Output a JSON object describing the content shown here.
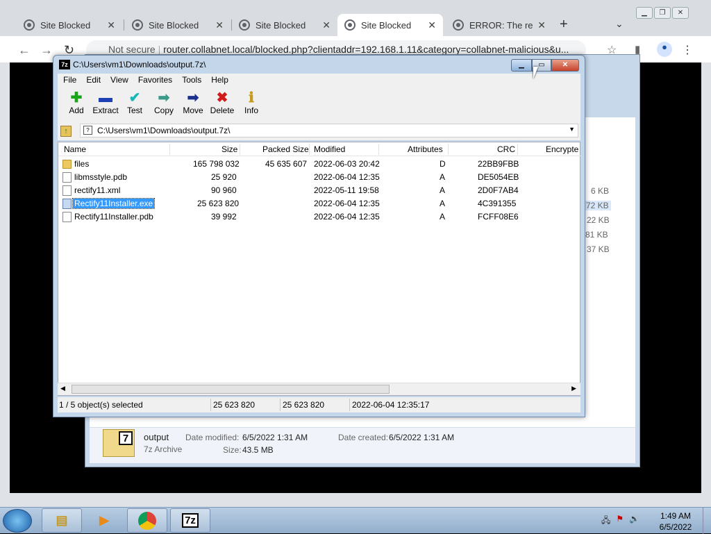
{
  "browser": {
    "tabs": [
      {
        "label": "Site Blocked"
      },
      {
        "label": "Site Blocked"
      },
      {
        "label": "Site Blocked"
      },
      {
        "label": "Site Blocked"
      },
      {
        "label": "ERROR: The requ"
      }
    ],
    "omnibox": {
      "security": "Not secure",
      "url": "router.collabnet.local/blocked.php?clientaddr=192.168.1.11&category=collabnet-malicious&u..."
    }
  },
  "background_explorer": {
    "sizes": [
      "6 KB",
      "72 KB",
      "22 KB",
      "81 KB",
      "37 KB"
    ],
    "details": {
      "name": "output",
      "type": "7z Archive",
      "modified_label": "Date modified:",
      "modified_value": "6/5/2022 1:31 AM",
      "created_label": "Date created:",
      "created_value": "6/5/2022 1:31 AM",
      "size_label": "Size:",
      "size_value": "43.5 MB"
    }
  },
  "sevenzip": {
    "title": "C:\\Users\\vm1\\Downloads\\output.7z\\",
    "menu": [
      "File",
      "Edit",
      "View",
      "Favorites",
      "Tools",
      "Help"
    ],
    "toolbar": [
      {
        "label": "Add",
        "glyph": "+",
        "color": "#1aa51a"
      },
      {
        "label": "Extract",
        "glyph": "━",
        "color": "#1c3fb5"
      },
      {
        "label": "Test",
        "glyph": "✔",
        "color": "#19b7b7"
      },
      {
        "label": "Copy",
        "glyph": "➡",
        "color": "#3a9a8a"
      },
      {
        "label": "Move",
        "glyph": "➡",
        "color": "#1b2f8f"
      },
      {
        "label": "Delete",
        "glyph": "✖",
        "color": "#d11a1a"
      },
      {
        "label": "Info",
        "glyph": "ℹ",
        "color": "#c79a1a"
      }
    ],
    "address": "C:\\Users\\vm1\\Downloads\\output.7z\\",
    "columns": [
      "Name",
      "Size",
      "Packed Size",
      "Modified",
      "Attributes",
      "CRC",
      "Encrypte"
    ],
    "rows": [
      {
        "name": "files",
        "size": "165 798 032",
        "packed": "45 635 607",
        "modified": "2022-06-03 20:42",
        "attr": "D",
        "crc": "22BB9FBB",
        "icon": "folder"
      },
      {
        "name": "libmsstyle.pdb",
        "size": "25 920",
        "packed": "",
        "modified": "2022-06-04 12:35",
        "attr": "A",
        "crc": "DE5054EB",
        "icon": "file"
      },
      {
        "name": "rectify11.xml",
        "size": "90 960",
        "packed": "",
        "modified": "2022-05-11 19:58",
        "attr": "A",
        "crc": "2D0F7AB4",
        "icon": "file"
      },
      {
        "name": "Rectify11Installer.exe",
        "size": "25 623 820",
        "packed": "",
        "modified": "2022-06-04 12:35",
        "attr": "A",
        "crc": "4C391355",
        "icon": "exe",
        "selected": true
      },
      {
        "name": "Rectify11Installer.pdb",
        "size": "39 992",
        "packed": "",
        "modified": "2022-06-04 12:35",
        "attr": "A",
        "crc": "FCFF08E6",
        "icon": "file"
      }
    ],
    "status": {
      "selection": "1 / 5 object(s) selected",
      "size": "25 623 820",
      "packed": "25 623 820",
      "modified": "2022-06-04 12:35:17"
    }
  },
  "taskbar": {
    "time": "1:49 AM",
    "date": "6/5/2022"
  }
}
